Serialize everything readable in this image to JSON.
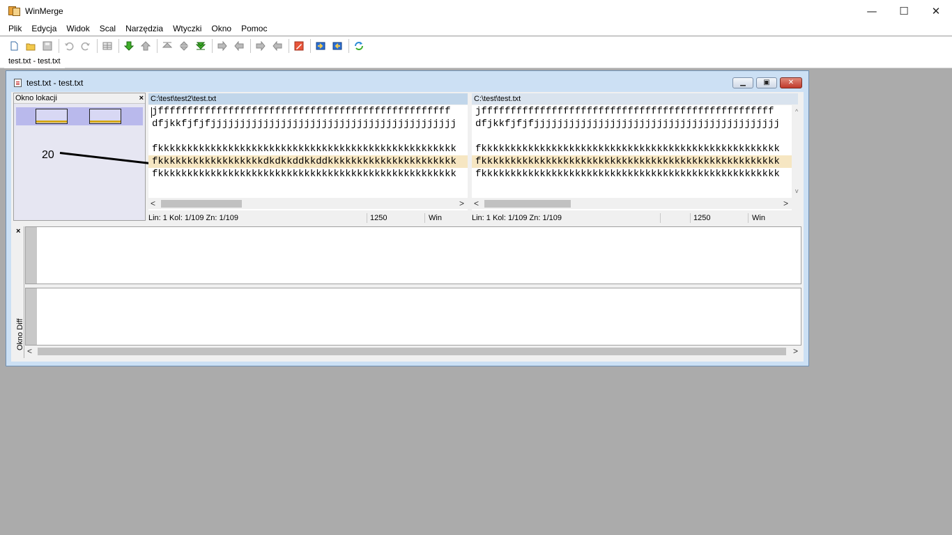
{
  "app": {
    "title": "WinMerge"
  },
  "window_controls": {
    "minimize": "—",
    "maximize": "☐",
    "close": "✕"
  },
  "menu": [
    "Plik",
    "Edycja",
    "Widok",
    "Scal",
    "Narzędzia",
    "Wtyczki",
    "Okno",
    "Pomoc"
  ],
  "toolbar": {
    "icons": [
      "new-icon",
      "open-icon",
      "save-icon",
      "undo-icon",
      "redo-icon",
      "options-icon",
      "next-diff-icon",
      "prev-diff-icon",
      "first-diff-icon",
      "current-diff-icon",
      "last-diff-icon",
      "copy-right-icon",
      "copy-left-icon",
      "copy-right-advance-icon",
      "copy-left-advance-icon",
      "edit-icon",
      "merge-right-icon",
      "merge-left-icon",
      "refresh-icon"
    ]
  },
  "tab": {
    "label": "test.txt - test.txt"
  },
  "child_window": {
    "title": "test.txt - test.txt",
    "btn_min": "▁",
    "btn_restore": "▣",
    "btn_close": "✕"
  },
  "location_pane": {
    "title": "Okno lokacji",
    "close": "×",
    "line_number": "20"
  },
  "left": {
    "path": "C:\\test\\test2\\test.txt",
    "lines": [
      "jffffffffffffffffffffffffffffffffffffffffffffffffff",
      "dfjkkfjfjfjjjjjjjjjjjjjjjjjjjjjjjjjjjjjjjjjjjjjjjjjj",
      "",
      "fkkkkkkkkkkkkkkkkkkkkkkkkkkkkkkkkkkkkkkkkkkkkkkkkkkk",
      "fkkkkkkkkkkkkkkkkkkdkdkkddkkddkkkkkkkkkkkkkkkkkkkkkk",
      "fkkkkkkkkkkkkkkkkkkkkkkkkkkkkkkkkkkkkkkkkkkkkkkkkkkk"
    ],
    "status": {
      "pos": "Lin: 1  Kol: 1/109  Zn: 1/109",
      "codepage": "1250",
      "eol": "Win"
    }
  },
  "right": {
    "path": "C:\\test\\test.txt",
    "lines": [
      "jffffffffffffffffffffffffffffffffffffffffffffffffff",
      "dfjkkfjfjfjjjjjjjjjjjjjjjjjjjjjjjjjjjjjjjjjjjjjjjjjj",
      "",
      "fkkkkkkkkkkkkkkkkkkkkkkkkkkkkkkkkkkkkkkkkkkkkkkkkkkk",
      "fkkkkkkkkkkkkkkkkkkkkkkkkkkkkkkkkkkkkkkkkkkkkkkkkkkk",
      "fkkkkkkkkkkkkkkkkkkkkkkkkkkkkkkkkkkkkkkkkkkkkkkkkkkk"
    ],
    "status": {
      "pos": "Lin: 1  Kol: 1/109  Zn: 1/109",
      "codepage": "1250",
      "eol": "Win"
    }
  },
  "diff_pane": {
    "label": "Okno Diff",
    "close": "×"
  },
  "scroll": {
    "left": "<",
    "right": ">",
    "up": "^",
    "down": "v"
  },
  "colors": {
    "diff_highlight": "#f6e6c2",
    "location_bar": "#d4a817",
    "active_path": "#c1d6ea"
  }
}
